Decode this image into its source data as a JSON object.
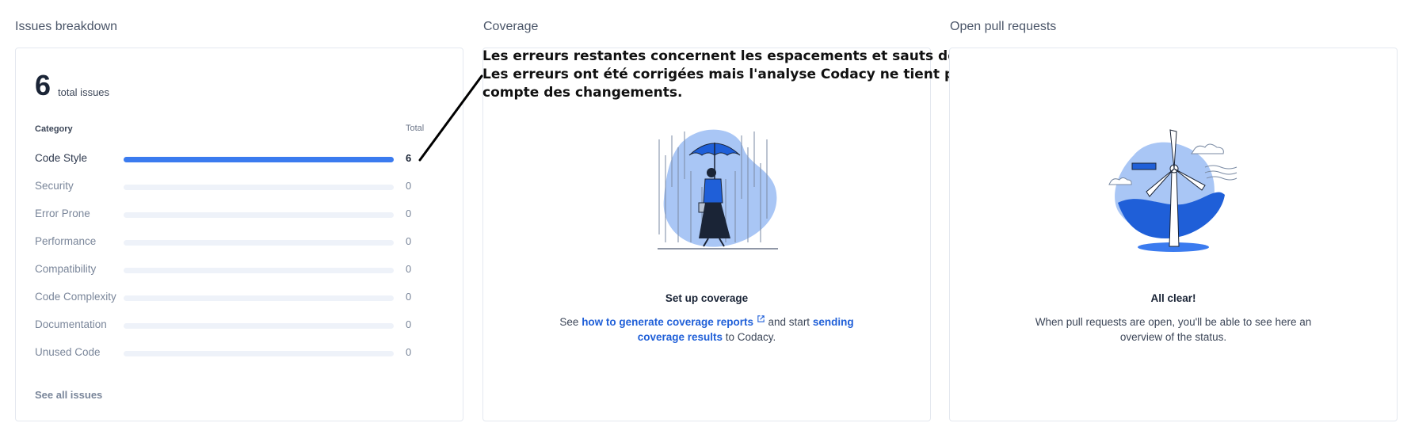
{
  "issues": {
    "section_title": "Issues breakdown",
    "total_count": "6",
    "total_label": "total issues",
    "header_category": "Category",
    "header_total": "Total",
    "categories": [
      {
        "label": "Code Style",
        "count": "6",
        "fraction": 1.0
      },
      {
        "label": "Security",
        "count": "0",
        "fraction": 0
      },
      {
        "label": "Error Prone",
        "count": "0",
        "fraction": 0
      },
      {
        "label": "Performance",
        "count": "0",
        "fraction": 0
      },
      {
        "label": "Compatibility",
        "count": "0",
        "fraction": 0
      },
      {
        "label": "Code Complexity",
        "count": "0",
        "fraction": 0
      },
      {
        "label": "Documentation",
        "count": "0",
        "fraction": 0
      },
      {
        "label": "Unused Code",
        "count": "0",
        "fraction": 0
      }
    ],
    "see_all": "See all issues",
    "bar_color": "#3b7bef"
  },
  "coverage": {
    "section_title": "Coverage",
    "annotation_lines": [
      "Les erreurs restantes concernent les espacements et sauts de lignes.",
      "Les erreurs ont été corrigées mais l'analyse Codacy ne tient pas",
      "compte des changements."
    ],
    "empty_title": "Set up coverage",
    "text_see": "See",
    "link_generate": "how to generate coverage reports",
    "text_and_start": "and start",
    "link_sending_1": "sending",
    "link_sending_2": "coverage results",
    "text_to_codacy": "to Codacy.",
    "link_color": "#1f5fd8"
  },
  "pull_requests": {
    "section_title": "Open pull requests",
    "empty_title": "All clear!",
    "empty_line1": "When pull requests are open, you'll be able to see here an",
    "empty_line2": "overview of the status."
  }
}
